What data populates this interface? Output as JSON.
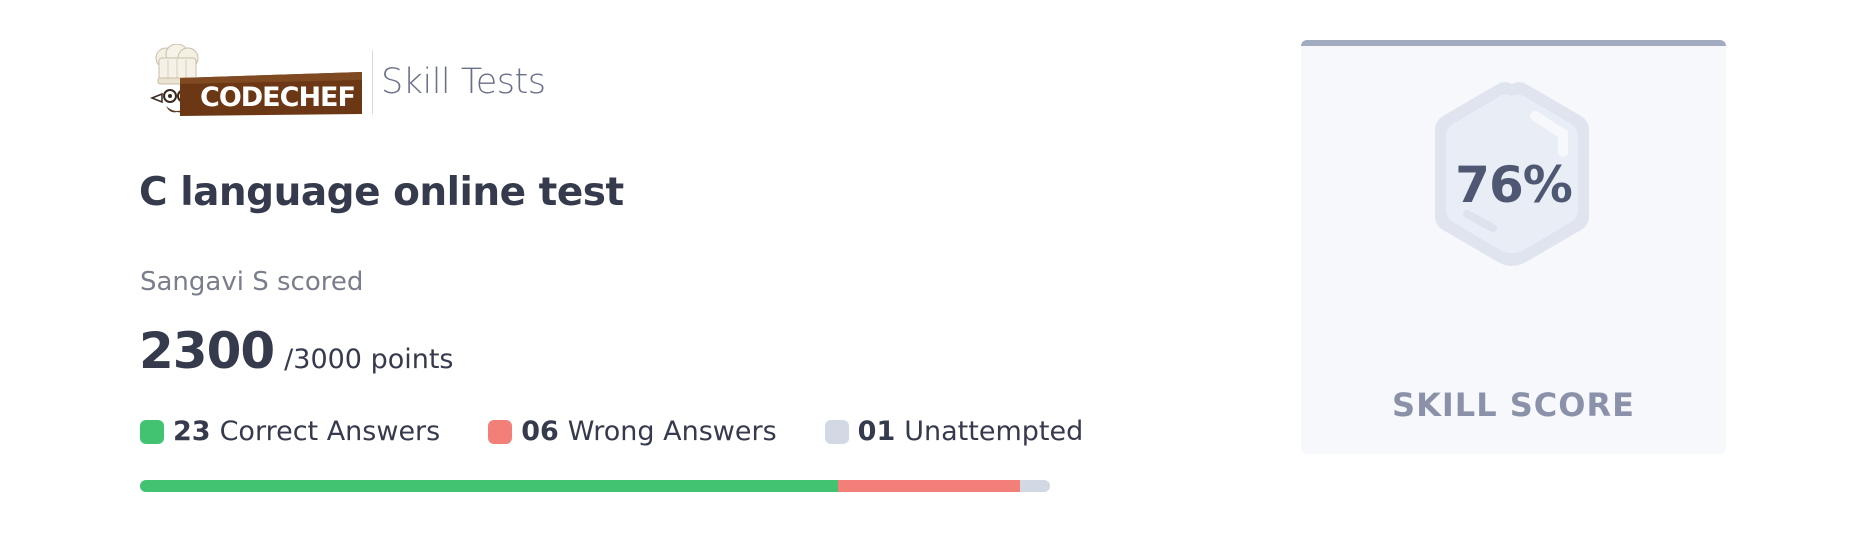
{
  "header": {
    "logo_text": "CODECHEF",
    "product_name": "Skill Tests"
  },
  "test": {
    "title": "C language online test"
  },
  "result": {
    "scored_by": "Sangavi S scored",
    "score": "2300",
    "score_total": "/3000 points"
  },
  "answers": [
    {
      "count": "23",
      "label": "Correct Answers",
      "color": "#42c371"
    },
    {
      "count": "06",
      "label": "Wrong Answers",
      "color": "#f28079"
    },
    {
      "count": "01",
      "label": "Unattempted",
      "color": "#d2d8e4"
    }
  ],
  "progress": {
    "correct_fraction": 0.767,
    "wrong_fraction": 0.2,
    "unattempted_fraction": 0.033
  },
  "skill": {
    "percent": "76%",
    "label": "SKILL SCORE"
  },
  "colors": {
    "card_top_border": "#a2abc0",
    "card_bg": "#f7f8fc",
    "logo_brown": "#6b3714"
  }
}
